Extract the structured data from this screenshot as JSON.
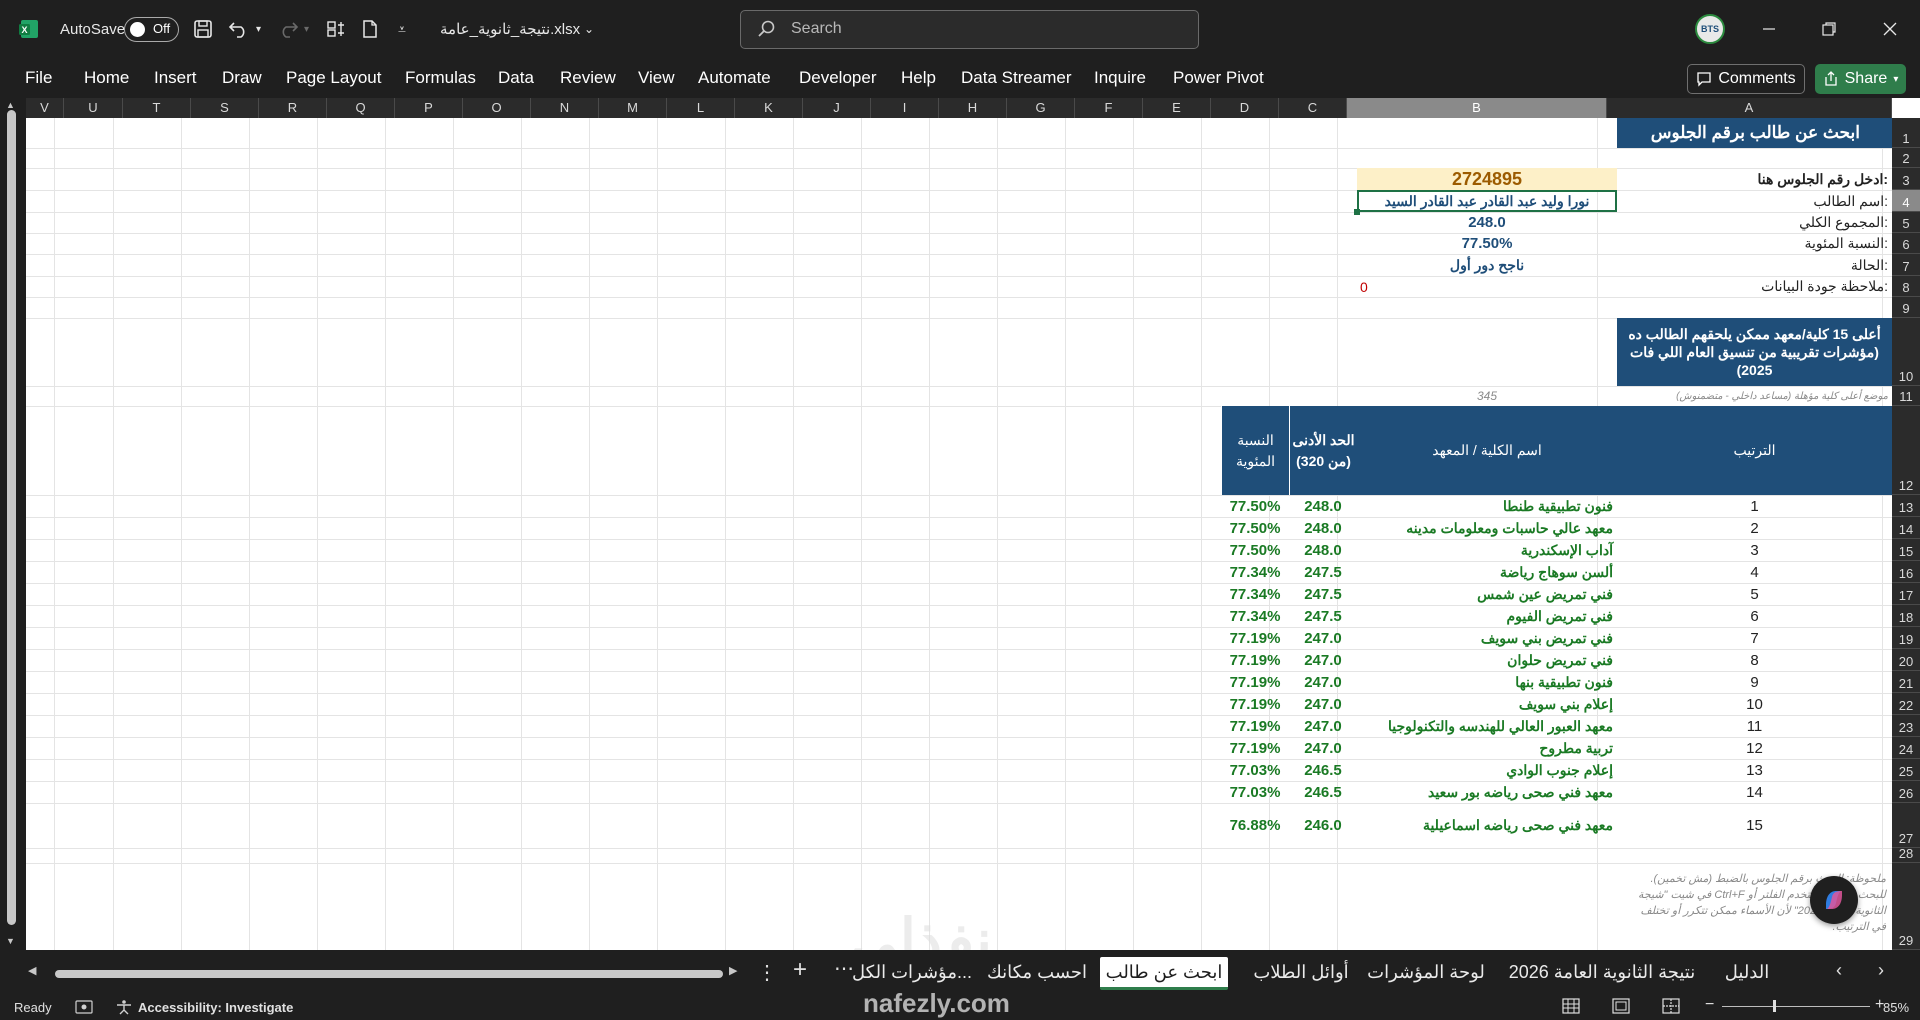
{
  "titlebar": {
    "autosave_label": "AutoSave",
    "autosave_state": "Off",
    "file_name": "نتيجة_ثانوية_عامة.xlsx",
    "search_placeholder": "Search",
    "avatar_text": "BTS"
  },
  "ribbon": {
    "tabs": [
      "File",
      "Home",
      "Insert",
      "Draw",
      "Page Layout",
      "Formulas",
      "Data",
      "Review",
      "View",
      "Automate",
      "Developer",
      "Help",
      "Data Streamer",
      "Inquire",
      "Power Pivot"
    ],
    "comments_label": "Comments",
    "share_label": "Share"
  },
  "columns": [
    "V",
    "U",
    "T",
    "S",
    "R",
    "Q",
    "P",
    "O",
    "N",
    "M",
    "L",
    "K",
    "J",
    "I",
    "H",
    "G",
    "F",
    "E",
    "D",
    "C",
    "B",
    "A"
  ],
  "rows": [
    "1",
    "2",
    "3",
    "4",
    "5",
    "6",
    "7",
    "8",
    "9",
    "10",
    "11",
    "12",
    "13",
    "14",
    "15",
    "16",
    "17",
    "18",
    "19",
    "20",
    "21",
    "22",
    "23",
    "24",
    "25",
    "26",
    "27",
    "28",
    "29"
  ],
  "sheet": {
    "title": "ابحث عن طالب برقم الجلوس",
    "labels": {
      "seat_prompt": "ادخل رقم الجلوس هنا:",
      "student_name": "اسم الطالب:",
      "total": "المجموع الكلي:",
      "percent": "النسبة المئوية:",
      "status": "الحالة:",
      "quality_note": "ملاحظة جودة البيانات:"
    },
    "values": {
      "seat_number": "2724895",
      "student_name": "نورا وليد عبد القادر عبد القادر السيد",
      "total": "248.0",
      "percent": "77.50%",
      "status": "ناجح دور أول",
      "quality_note": "0"
    },
    "top15_header": "أعلى 15 كلية/معهد ممكن يلحقهم الطالب ده (مؤشرات تقريبية من تنسيق العام اللي فات 2025)",
    "rank_note": "موضع أعلى كلية مؤهلة (مساعد داخلي - متضمنوش)",
    "rank_value": "345",
    "table_headers": {
      "rank": "الترتيب",
      "college": "اسم الكلية / المعهد",
      "min_score": "الحد الأدنى (من 320)",
      "percent": "النسبة المئوية"
    },
    "table_rows": [
      {
        "rank": "1",
        "college": "فنون تطبيقية طنطا",
        "min": "248.0",
        "pct": "77.50%"
      },
      {
        "rank": "2",
        "college": "معهد عالي حاسبات ومعلومات مدينه",
        "min": "248.0",
        "pct": "77.50%"
      },
      {
        "rank": "3",
        "college": "آداب الإسكندرية",
        "min": "248.0",
        "pct": "77.50%"
      },
      {
        "rank": "4",
        "college": "ألسن سوهاج رياضة",
        "min": "247.5",
        "pct": "77.34%"
      },
      {
        "rank": "5",
        "college": "فني تمريض عين شمس",
        "min": "247.5",
        "pct": "77.34%"
      },
      {
        "rank": "6",
        "college": "فني تمريض الفيوم",
        "min": "247.5",
        "pct": "77.34%"
      },
      {
        "rank": "7",
        "college": "فني تمريض بني سويف",
        "min": "247.0",
        "pct": "77.19%"
      },
      {
        "rank": "8",
        "college": "فني تمريض حلوان",
        "min": "247.0",
        "pct": "77.19%"
      },
      {
        "rank": "9",
        "college": "فنون تطبيقية بنها",
        "min": "247.0",
        "pct": "77.19%"
      },
      {
        "rank": "10",
        "college": "إعلام بني سويف",
        "min": "247.0",
        "pct": "77.19%"
      },
      {
        "rank": "11",
        "college": "معهد العبور العالي للهندسه والتكنولوجيا",
        "min": "247.0",
        "pct": "77.19%"
      },
      {
        "rank": "12",
        "college": "تربية مطروح",
        "min": "247.0",
        "pct": "77.19%"
      },
      {
        "rank": "13",
        "college": "إعلام جنوب الوادي",
        "min": "246.5",
        "pct": "77.03%"
      },
      {
        "rank": "14",
        "college": "معهد فني صحى رياضه بور سعيد",
        "min": "246.5",
        "pct": "77.03%"
      },
      {
        "rank": "15",
        "college": "معهد فني صحى رياضه اسماعيلية",
        "min": "246.0",
        "pct": "76.88%"
      }
    ],
    "footnote": "ملحوظة: البحث برقم الجلوس بالضبط (مش تخمين). للبحث بالاسم استخدم الفلتر أو Ctrl+F في شيت \"شيجة الثانوية العامة 2026\" لأن الأسماء ممكن تتكرر أو تختلف في الترتيب."
  },
  "sheet_tabs": [
    "الدليل",
    "نتيجة الثانوية العامة 2026",
    "لوحة المؤشرات",
    "أوائل الطلاب",
    "ابحث عن طالب",
    "احسب مكانك",
    "مؤشرات الكل..."
  ],
  "active_tab": "ابحث عن طالب",
  "watermark": {
    "brand": "نفذلي",
    "url": "nafezly.com"
  },
  "statusbar": {
    "ready": "Ready",
    "accessibility": "Accessibility: Investigate",
    "zoom": "85%"
  },
  "colors": {
    "navy": "#1f4e79",
    "seat_fill": "#fdf0c8",
    "seat_text": "#9c5b00",
    "green_text": "#1a7a24",
    "share_green": "#2f7d4b"
  }
}
